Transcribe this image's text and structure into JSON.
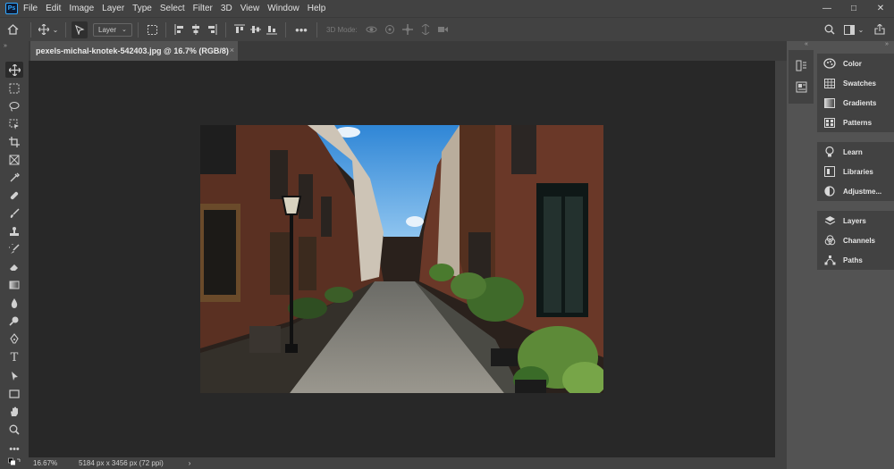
{
  "app": {
    "logo": "Ps"
  },
  "menu": [
    "File",
    "Edit",
    "Image",
    "Layer",
    "Type",
    "Select",
    "Filter",
    "3D",
    "View",
    "Window",
    "Help"
  ],
  "window_controls": {
    "minimize": "—",
    "maximize": "□",
    "close": "✕"
  },
  "options_bar": {
    "layer_select": "Layer",
    "mode_3d_label": "3D Mode:"
  },
  "document": {
    "tab_title": "pexels-michal-knotek-542403.jpg @ 16.7% (RGB/8)",
    "close": "×"
  },
  "status": {
    "zoom": "16.67%",
    "doc_size": "5184 px x 3456 px (72 ppi)",
    "arrow": "›"
  },
  "panels": {
    "group1": [
      {
        "label": "Color",
        "icon": "color-icon"
      },
      {
        "label": "Swatches",
        "icon": "swatches-icon"
      },
      {
        "label": "Gradients",
        "icon": "gradients-icon"
      },
      {
        "label": "Patterns",
        "icon": "patterns-icon"
      }
    ],
    "group2": [
      {
        "label": "Learn",
        "icon": "learn-icon"
      },
      {
        "label": "Libraries",
        "icon": "libraries-icon"
      },
      {
        "label": "Adjustme...",
        "icon": "adjustments-icon"
      }
    ],
    "group3": [
      {
        "label": "Layers",
        "icon": "layers-icon"
      },
      {
        "label": "Channels",
        "icon": "channels-icon"
      },
      {
        "label": "Paths",
        "icon": "paths-icon"
      }
    ]
  },
  "colors": {
    "chrome": "#424242",
    "workspace": "#535353",
    "canvas_bg": "#282828",
    "accent": "#31a8ff"
  }
}
